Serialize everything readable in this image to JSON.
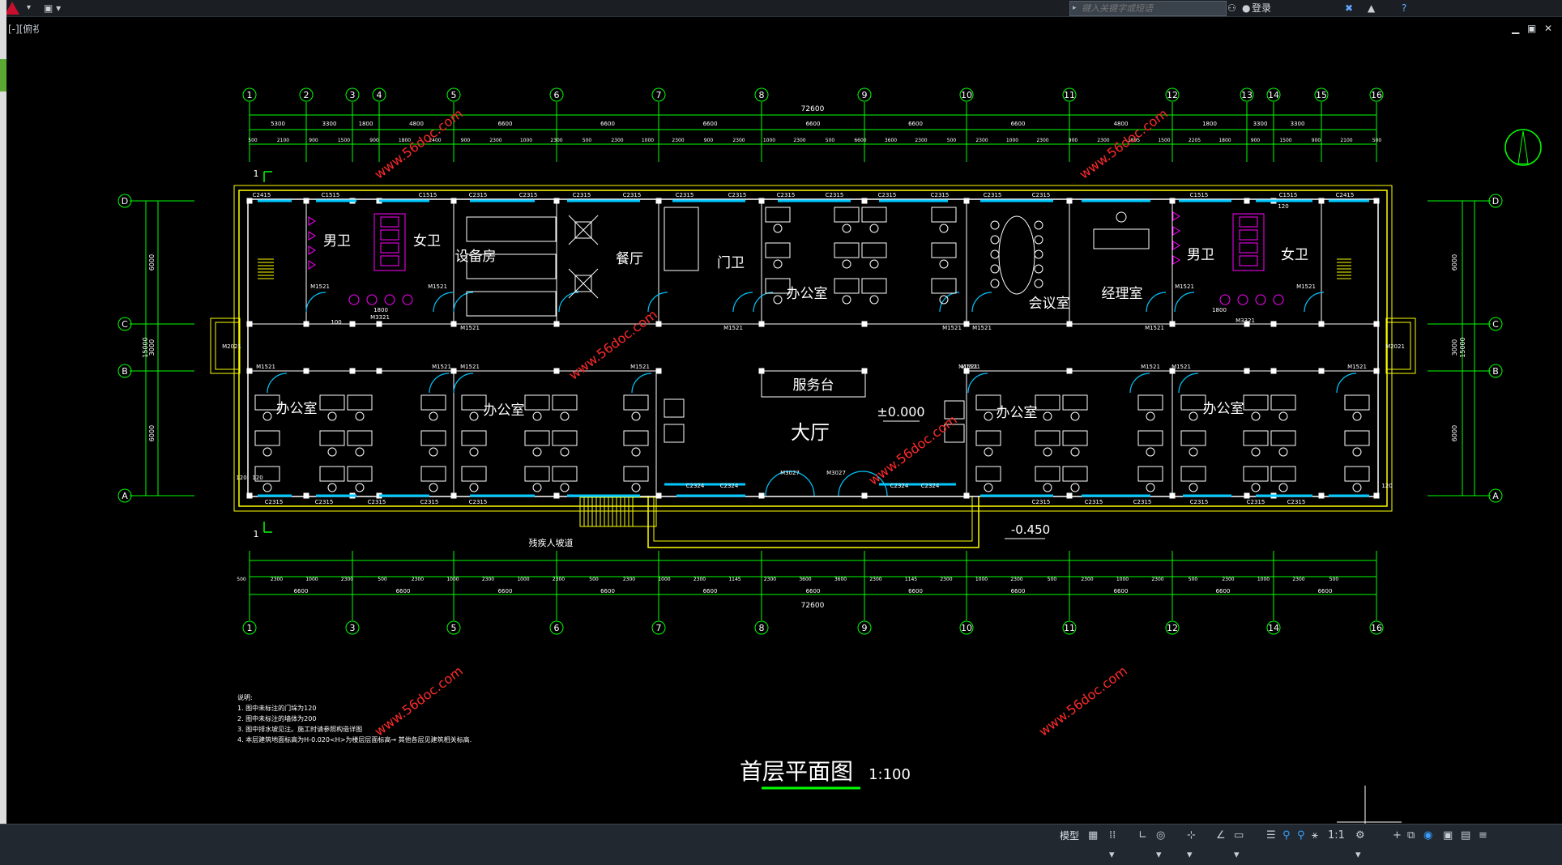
{
  "search": {
    "placeholder": "键入关键字或短语"
  },
  "user": {
    "login_label": "登录"
  },
  "viewport": {
    "label": "[-][俯视][二维线框]"
  },
  "drawing": {
    "title": "首层平面图",
    "scale": "1:100",
    "elev_floor": "±0.000",
    "elev_outside": "-0.450",
    "ramp_label": "残疾人坡道",
    "total_dim": "72600",
    "total_dim_bottom": "72600",
    "rooms": {
      "men_wc": "男卫",
      "women_wc": "女卫",
      "equipment": "设备房",
      "dining": "餐厅",
      "guard": "门卫",
      "office": "办公室",
      "meeting": "会议室",
      "manager": "经理室",
      "service_desk": "服务台",
      "hall": "大厅"
    },
    "axis_top": [
      "1",
      "2",
      "3",
      "4",
      "5",
      "6",
      "7",
      "8",
      "9",
      "10",
      "11",
      "12",
      "13",
      "14",
      "15",
      "16"
    ],
    "axis_bottom": [
      "1",
      "3",
      "5",
      "6",
      "7",
      "8",
      "9",
      "10",
      "11",
      "12",
      "14",
      "16"
    ],
    "axis_side": [
      "D",
      "C",
      "B",
      "A"
    ],
    "top_dims_row1": [
      "5300",
      "3300",
      "1800",
      "4800",
      "6600",
      "6600",
      "6600",
      "6600",
      "6600",
      "6600",
      "4800",
      "1800",
      "3300",
      "3300"
    ],
    "top_dims_row2": [
      "500",
      "2100",
      "900",
      "1500",
      "900",
      "1800",
      "2400",
      "900",
      "2300",
      "1000",
      "2300",
      "500",
      "2300",
      "1000",
      "2300",
      "900",
      "2300",
      "1000",
      "2300",
      "500",
      "6600",
      "3600",
      "2300",
      "500",
      "2300",
      "1000",
      "2300",
      "900",
      "2300",
      "1895",
      "1500",
      "2205",
      "1800",
      "900",
      "1500",
      "900",
      "2100",
      "500"
    ],
    "bottom_dims_row1": [
      "500",
      "2300",
      "1000",
      "2300",
      "500",
      "2300",
      "1000",
      "2300",
      "1000",
      "2300",
      "500",
      "2300",
      "1000",
      "2300",
      "1145",
      "2300",
      "3600",
      "3600",
      "2300",
      "1145",
      "2300",
      "1000",
      "2300",
      "500",
      "2300",
      "1000",
      "2300",
      "500",
      "2300",
      "1000",
      "2300",
      "500"
    ],
    "bottom_dims_row2": [
      "6600",
      "6600",
      "6600",
      "6600",
      "6600",
      "6600",
      "6600",
      "6600",
      "6600",
      "6600",
      "6600"
    ],
    "side_dims": [
      "6000",
      "3000",
      "6000",
      "15000"
    ],
    "door_labels": [
      "M1521",
      "M1521",
      "M1521",
      "M1521",
      "M1521",
      "M1521",
      "M1521",
      "M1521",
      "M1521",
      "M1521",
      "M1521",
      "M1521",
      "M1521",
      "M1521",
      "M1521",
      "M1521",
      "M3027",
      "M3027",
      "M2021",
      "M2021",
      "M3321",
      "M3321",
      "M1521",
      "M1521"
    ],
    "window_labels": [
      "C2415",
      "C1515",
      "C1515",
      "C2315",
      "C2315",
      "C2315",
      "C2315",
      "C2315",
      "C2315",
      "C2315",
      "C2315",
      "C2315",
      "C2315",
      "C2315",
      "C2315",
      "C1515",
      "C1515",
      "C2415",
      "C2315",
      "C2315",
      "C2315",
      "C2315",
      "C2315",
      "C2324",
      "C2324",
      "C2324",
      "C2324",
      "C2315",
      "C2315",
      "C2315",
      "C2315",
      "C2315",
      "C2315"
    ],
    "dim_misc": [
      "120",
      "120",
      "120",
      "120",
      "1800",
      "1800",
      "100"
    ],
    "notes": [
      "说明:",
      "1. 图中未标注的门垛为120",
      "2. 图中未标注的墙体为200",
      "3. 图中排水坡见注。施工时请参照构造详图",
      "4. 本层建筑地面标高为H-0.020<H>为楼层层面标高→ 其他各层见建筑相关标高."
    ],
    "section_marks": [
      "1",
      "1"
    ]
  },
  "watermark": "www.56doc.com",
  "statusbar": {
    "model_tab": "模型",
    "scale": "1:1"
  },
  "colors": {
    "wall": "#ffffff",
    "dim": "#00ff00",
    "window": "#00c8ff",
    "fixture": "#ff00ff",
    "outline": "#ffff00",
    "watermark": "#ff2a2a"
  }
}
